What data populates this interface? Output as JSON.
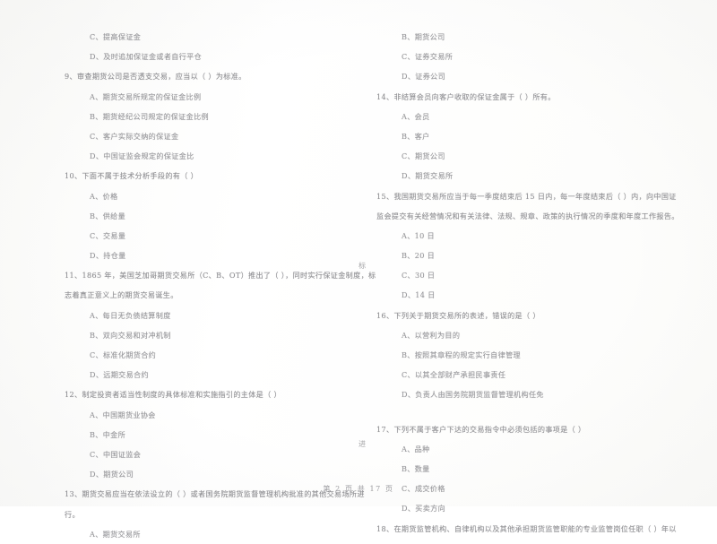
{
  "document": {
    "type": "scanned-exam-paper",
    "language": "zh-CN",
    "footer": "第 2 页 共 17 页"
  },
  "left_column": {
    "orphan_options": [
      "C、提高保证金",
      "D、及时追加保证金或者自行平仓"
    ],
    "questions": [
      {
        "number": "9",
        "text": "9、审查期货公司是否透支交易，应当以（      ）为标准。",
        "options": [
          "A、期货交易所规定的保证金比例",
          "B、期货经纪公司规定的保证金比例",
          "C、客户实际交纳的保证金",
          "D、中国证监会规定的保证金比"
        ]
      },
      {
        "number": "10",
        "text": "10、下面不属于技术分析手段的有（      ）",
        "options": [
          "A、价格",
          "B、供给量",
          "C、交易量",
          "D、持仓量"
        ]
      },
      {
        "number": "11",
        "text": "11、1865 年，美国芝加哥期货交易所（C、B、OT）推出了（      ），同时实行保证金制度，标",
        "continuation": "志着真正意义上的期货交易诞生。",
        "options": [
          "A、每日无负债结算制度",
          "B、双向交易和对冲机制",
          "C、标准化期货合约",
          "D、远期交易合约"
        ]
      },
      {
        "number": "12",
        "text": "12、制定投资者适当性制度的具体标准和实施指引的主体是（      ）",
        "options": [
          "A、中国期货业协会",
          "B、中金所",
          "C、中国证监会",
          "D、期货公司"
        ]
      },
      {
        "number": "13",
        "text": "13、期货交易应当在依法设立的（      ）或者国务院期货监督管理机构批准的其他交易场所进",
        "continuation": "行。",
        "options": [
          "A、期货交易所"
        ]
      }
    ]
  },
  "right_column": {
    "orphan_options": [
      "B、期货公司",
      "C、证券交易所",
      "D、证券公司"
    ],
    "questions": [
      {
        "number": "14",
        "text": "14、非结算会员向客户收取的保证金属于（      ）所有。",
        "options": [
          "A、会员",
          "B、客户",
          "C、期货公司",
          "D、期货交易所"
        ]
      },
      {
        "number": "15",
        "text": "15、我国期货交易所应当于每一季度结束后 15 日内，每一年度结束后（      ）内，向中国证",
        "continuation": "监会提交有关经营情况和有关法律、法规、规章、政策的执行情况的季度和年度工作报告。",
        "options": [
          "A、10 日",
          "B、20 日",
          "C、30 日",
          "D、14 日"
        ]
      },
      {
        "number": "16",
        "text": "16、下列关于期货交易所的表述，错误的是（      ）",
        "options": [
          "A、以营利为目的",
          "B、按照其章程的规定实行自律管理",
          "C、以其全部财产承担民事责任",
          "D、负责人由国务院期货监督管理机构任免"
        ]
      },
      {
        "number": "17",
        "text": "17、下列不属于客户下达的交易指令中必须包括的事项是（      ）",
        "options": [
          "A、品种",
          "B、数量",
          "C、成交价格",
          "D、买卖方向"
        ]
      },
      {
        "number": "18",
        "text": "18、在期货监管机构、自律机构以及其他承担期货监管职能的专业监管岗位任职（      ）年以",
        "options": []
      }
    ]
  },
  "bleed_marks": {
    "mark_1": "标",
    "mark_2": "进"
  }
}
